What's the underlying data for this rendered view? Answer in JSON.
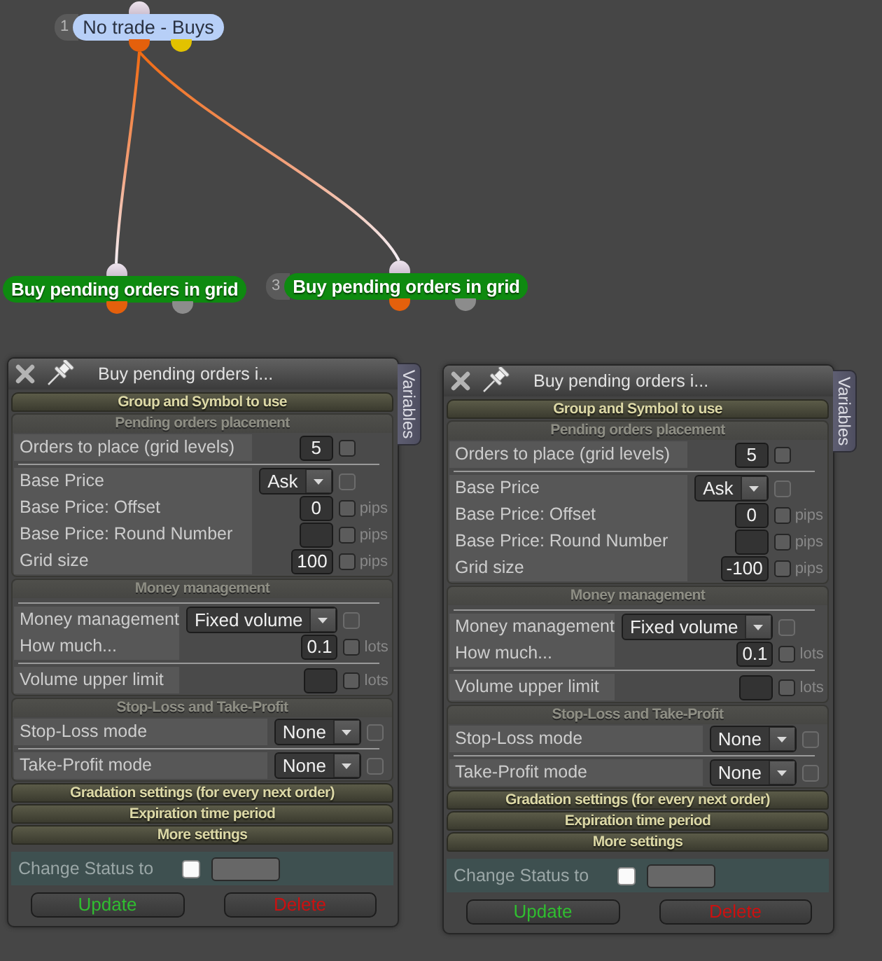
{
  "canvas": {
    "nodes": [
      {
        "number": "1",
        "label": "No trade - Buys",
        "kind": "status",
        "color": "#b7cff7",
        "outputs": [
          {
            "color": "#e4600c"
          },
          {
            "color": "#e2c200"
          }
        ],
        "children": [
          {
            "label": "Buy pending orders in grid",
            "kind": "action",
            "color": "#0e8a10",
            "outputs": [
              {
                "color": "#e4600c"
              },
              {
                "color": "#8c8c8c"
              }
            ]
          },
          {
            "number": "3",
            "label": "Buy pending orders in grid",
            "kind": "action",
            "color": "#0e8a10",
            "outputs": [
              {
                "color": "#e4600c"
              },
              {
                "color": "#8c8c8c"
              }
            ]
          }
        ]
      }
    ]
  },
  "panels": [
    {
      "title": "Buy pending orders i...",
      "side_tab": "Variables",
      "sections": [
        {
          "title": "Group and Symbol to use",
          "expanded": false
        },
        {
          "title": "Pending orders placement",
          "expanded": true,
          "rows": [
            {
              "label": "Orders to place (grid levels)",
              "kind": "number",
              "value": "5",
              "separator_above": false,
              "checkbox": {
                "checked": false,
                "disabled": false
              }
            },
            {
              "label": "Base Price",
              "kind": "dropdown",
              "value": "Ask",
              "separator_above": true,
              "checkbox": {
                "checked": false,
                "disabled": true
              }
            },
            {
              "label": "Base Price: Offset",
              "kind": "number",
              "value": "0",
              "unit": "pips",
              "separator_above": false,
              "checkbox": {
                "checked": false,
                "disabled": false
              }
            },
            {
              "label": "Base Price: Round Number",
              "kind": "number",
              "unit": "pips",
              "separator_above": false,
              "checkbox": {
                "checked": false,
                "disabled": false
              }
            },
            {
              "label": "Grid size",
              "kind": "number",
              "value": "100",
              "unit": "pips",
              "separator_above": false,
              "checkbox": {
                "checked": false,
                "disabled": false
              }
            }
          ]
        },
        {
          "title": "Money management",
          "expanded": true,
          "rows": [
            {
              "label": "Money management",
              "kind": "dropdown",
              "value": "Fixed volume",
              "separator_above": true,
              "checkbox": {
                "checked": false,
                "disabled": true
              }
            },
            {
              "label": "How much...",
              "kind": "number",
              "value": "0.1",
              "unit": "lots",
              "separator_above": false,
              "checkbox": {
                "checked": false,
                "disabled": false
              }
            },
            {
              "label": "Volume upper limit",
              "kind": "number",
              "unit": "lots",
              "separator_above": true,
              "checkbox": {
                "checked": false,
                "disabled": false
              }
            }
          ]
        },
        {
          "title": "Stop-Loss and Take-Profit",
          "expanded": true,
          "rows": [
            {
              "label": "Stop-Loss mode",
              "kind": "dropdown",
              "value": "None",
              "separator_above": false,
              "checkbox": {
                "checked": false,
                "disabled": true
              }
            },
            {
              "label": "Take-Profit mode",
              "kind": "dropdown",
              "value": "None",
              "separator_above": true,
              "checkbox": {
                "checked": false,
                "disabled": true
              }
            }
          ]
        },
        {
          "title": "Gradation settings (for every next order)",
          "expanded": false
        },
        {
          "title": "Expiration time period",
          "expanded": false
        },
        {
          "title": "More settings",
          "expanded": false
        }
      ],
      "status": {
        "label": "Change Status to",
        "checked": false
      },
      "buttons": [
        {
          "label": "Update",
          "kind": "update"
        },
        {
          "label": "Delete",
          "kind": "delete"
        }
      ]
    },
    {
      "title": "Buy pending orders i...",
      "side_tab": "Variables",
      "sections": [
        {
          "title": "Group and Symbol to use",
          "expanded": false
        },
        {
          "title": "Pending orders placement",
          "expanded": true,
          "rows": [
            {
              "label": "Orders to place (grid levels)",
              "kind": "number",
              "value": "5",
              "separator_above": false,
              "checkbox": {
                "checked": false,
                "disabled": false
              }
            },
            {
              "label": "Base Price",
              "kind": "dropdown",
              "value": "Ask",
              "separator_above": true,
              "checkbox": {
                "checked": false,
                "disabled": true
              }
            },
            {
              "label": "Base Price: Offset",
              "kind": "number",
              "value": "0",
              "unit": "pips",
              "separator_above": false,
              "checkbox": {
                "checked": false,
                "disabled": false
              }
            },
            {
              "label": "Base Price: Round Number",
              "kind": "number",
              "unit": "pips",
              "separator_above": false,
              "checkbox": {
                "checked": false,
                "disabled": false
              }
            },
            {
              "label": "Grid size",
              "kind": "number",
              "value": "-100",
              "unit": "pips",
              "separator_above": false,
              "checkbox": {
                "checked": false,
                "disabled": false
              }
            }
          ]
        },
        {
          "title": "Money management",
          "expanded": true,
          "rows": [
            {
              "label": "Money management",
              "kind": "dropdown",
              "value": "Fixed volume",
              "separator_above": true,
              "checkbox": {
                "checked": false,
                "disabled": true
              }
            },
            {
              "label": "How much...",
              "kind": "number",
              "value": "0.1",
              "unit": "lots",
              "separator_above": false,
              "checkbox": {
                "checked": false,
                "disabled": false
              }
            },
            {
              "label": "Volume upper limit",
              "kind": "number",
              "unit": "lots",
              "separator_above": true,
              "checkbox": {
                "checked": false,
                "disabled": false
              }
            }
          ]
        },
        {
          "title": "Stop-Loss and Take-Profit",
          "expanded": true,
          "rows": [
            {
              "label": "Stop-Loss mode",
              "kind": "dropdown",
              "value": "None",
              "separator_above": false,
              "checkbox": {
                "checked": false,
                "disabled": true
              }
            },
            {
              "label": "Take-Profit mode",
              "kind": "dropdown",
              "value": "None",
              "separator_above": true,
              "checkbox": {
                "checked": false,
                "disabled": true
              }
            }
          ]
        },
        {
          "title": "Gradation settings (for every next order)",
          "expanded": false
        },
        {
          "title": "Expiration time period",
          "expanded": false
        },
        {
          "title": "More settings",
          "expanded": false
        }
      ],
      "status": {
        "label": "Change Status to",
        "checked": false
      },
      "buttons": [
        {
          "label": "Update",
          "kind": "update"
        },
        {
          "label": "Delete",
          "kind": "delete"
        }
      ]
    }
  ]
}
